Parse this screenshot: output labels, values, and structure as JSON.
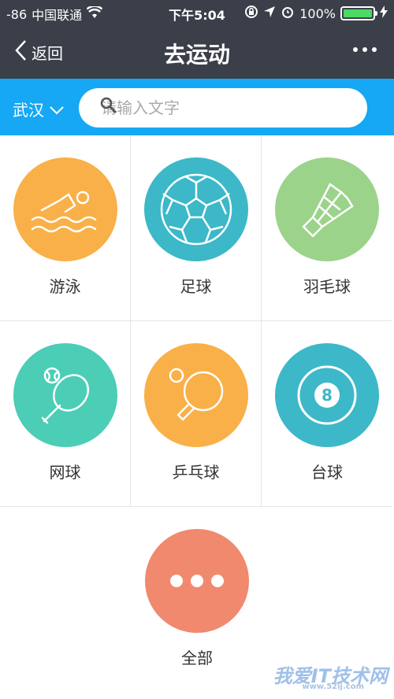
{
  "status_bar": {
    "signal": "-86",
    "carrier": "中国联通",
    "time": "下午5:04",
    "battery": "100%"
  },
  "nav": {
    "back_label": "返回",
    "title": "去运动"
  },
  "search": {
    "city": "武汉",
    "placeholder": "请输入文字"
  },
  "sports": [
    {
      "label": "游泳",
      "color": "#f9b048",
      "icon": "swimming-icon"
    },
    {
      "label": "足球",
      "color": "#3cb8c8",
      "icon": "soccer-ball-icon"
    },
    {
      "label": "羽毛球",
      "color": "#9bd38a",
      "icon": "shuttlecock-icon"
    },
    {
      "label": "网球",
      "color": "#4ccdb6",
      "icon": "tennis-icon"
    },
    {
      "label": "乒乓球",
      "color": "#f9b048",
      "icon": "ping-pong-icon"
    },
    {
      "label": "台球",
      "color": "#3cb8c8",
      "icon": "billiard-ball-icon"
    },
    {
      "label": "全部",
      "color": "#f0896e",
      "icon": "more-icon"
    }
  ],
  "watermark": {
    "text": "我爱IT技术网",
    "subtext": "www.52ij.com"
  },
  "colors": {
    "header_bg": "#3a3f49",
    "search_bar_bg": "#16a8f4",
    "battery_fill": "#4cd964"
  }
}
